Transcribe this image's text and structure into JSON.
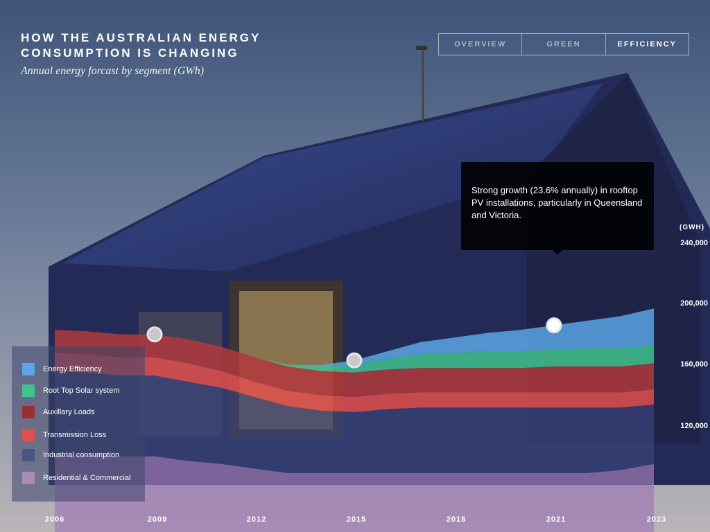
{
  "header": {
    "title_line1": "HOW THE AUSTRALIAN ENERGY",
    "title_line2": "CONSUMPTION IS CHANGING",
    "subtitle": "Annual energy forcast by segment (GWh)"
  },
  "tabs": [
    {
      "label": "OVERVIEW",
      "active": false
    },
    {
      "label": "GREEN",
      "active": false
    },
    {
      "label": "EFFICIENCY",
      "active": true
    }
  ],
  "tooltip": {
    "text": "Strong growth (23.6% annually) in rooftop PV installations, particularly in Queensland and Victoria."
  },
  "chart_data": {
    "type": "area",
    "stacked": true,
    "x": [
      2006,
      2007,
      2008,
      2009,
      2010,
      2011,
      2012,
      2013,
      2014,
      2015,
      2016,
      2017,
      2018,
      2019,
      2020,
      2021,
      2022,
      2023,
      2024
    ],
    "x_ticks": [
      "2006",
      "2009",
      "2012",
      "2015",
      "2018",
      "2021",
      "2023"
    ],
    "unit_label": "(GWH)",
    "y_ticks": [
      "240,000",
      "200,000",
      "160,000",
      "120,000"
    ],
    "y_tick_values": [
      240000,
      200000,
      160000,
      120000
    ],
    "series": [
      {
        "name": "Residential & Commercial",
        "color": "#a07bb5",
        "opacity": 0.72,
        "values": [
          102000,
          102000,
          101000,
          101000,
          98000,
          96000,
          93000,
          90000,
          90000,
          90000,
          90000,
          90000,
          90000,
          90000,
          90000,
          90000,
          90000,
          92000,
          96000
        ]
      },
      {
        "name": "Industrial consumption",
        "color": "#3b447a",
        "opacity": 0.7,
        "values": [
          55000,
          54000,
          53000,
          53000,
          52000,
          50000,
          47000,
          44000,
          41000,
          40000,
          42000,
          43000,
          43000,
          43000,
          43000,
          43000,
          43000,
          41000,
          39000
        ]
      },
      {
        "name": "Transmission Loss",
        "color": "#e0504e",
        "opacity": 0.85,
        "values": [
          12000,
          12000,
          12000,
          12000,
          12000,
          11000,
          10000,
          10000,
          10000,
          10000,
          10000,
          10000,
          10000,
          10000,
          10000,
          10000,
          10000,
          10000,
          10000
        ]
      },
      {
        "name": "Auxillary Loads",
        "color": "#b2383c",
        "opacity": 0.85,
        "values": [
          15000,
          15000,
          15000,
          15000,
          16000,
          16000,
          16000,
          16000,
          16000,
          16000,
          16000,
          16000,
          16000,
          16000,
          16000,
          17000,
          17000,
          17000,
          17000
        ]
      },
      {
        "name": "Root Top Solar system",
        "color": "#3fc38e",
        "opacity": 0.85,
        "values": [
          0,
          0,
          0,
          0,
          0,
          0,
          0,
          1000,
          3000,
          5000,
          7000,
          9000,
          10000,
          11000,
          11000,
          11000,
          12000,
          12000,
          12000
        ]
      },
      {
        "name": "Energy Efficiency",
        "color": "#5aa6e6",
        "opacity": 0.85,
        "values": [
          0,
          0,
          0,
          0,
          0,
          0,
          0,
          0,
          1000,
          3000,
          5000,
          8000,
          10000,
          12000,
          14000,
          16000,
          18000,
          21000,
          24000
        ]
      }
    ],
    "markers": [
      {
        "x": 2009,
        "value": 181000,
        "highlight": false
      },
      {
        "x": 2015,
        "value": 164000,
        "highlight": false
      },
      {
        "x": 2021,
        "value": 187000,
        "highlight": true
      }
    ],
    "legend_position": "bottom-left"
  }
}
